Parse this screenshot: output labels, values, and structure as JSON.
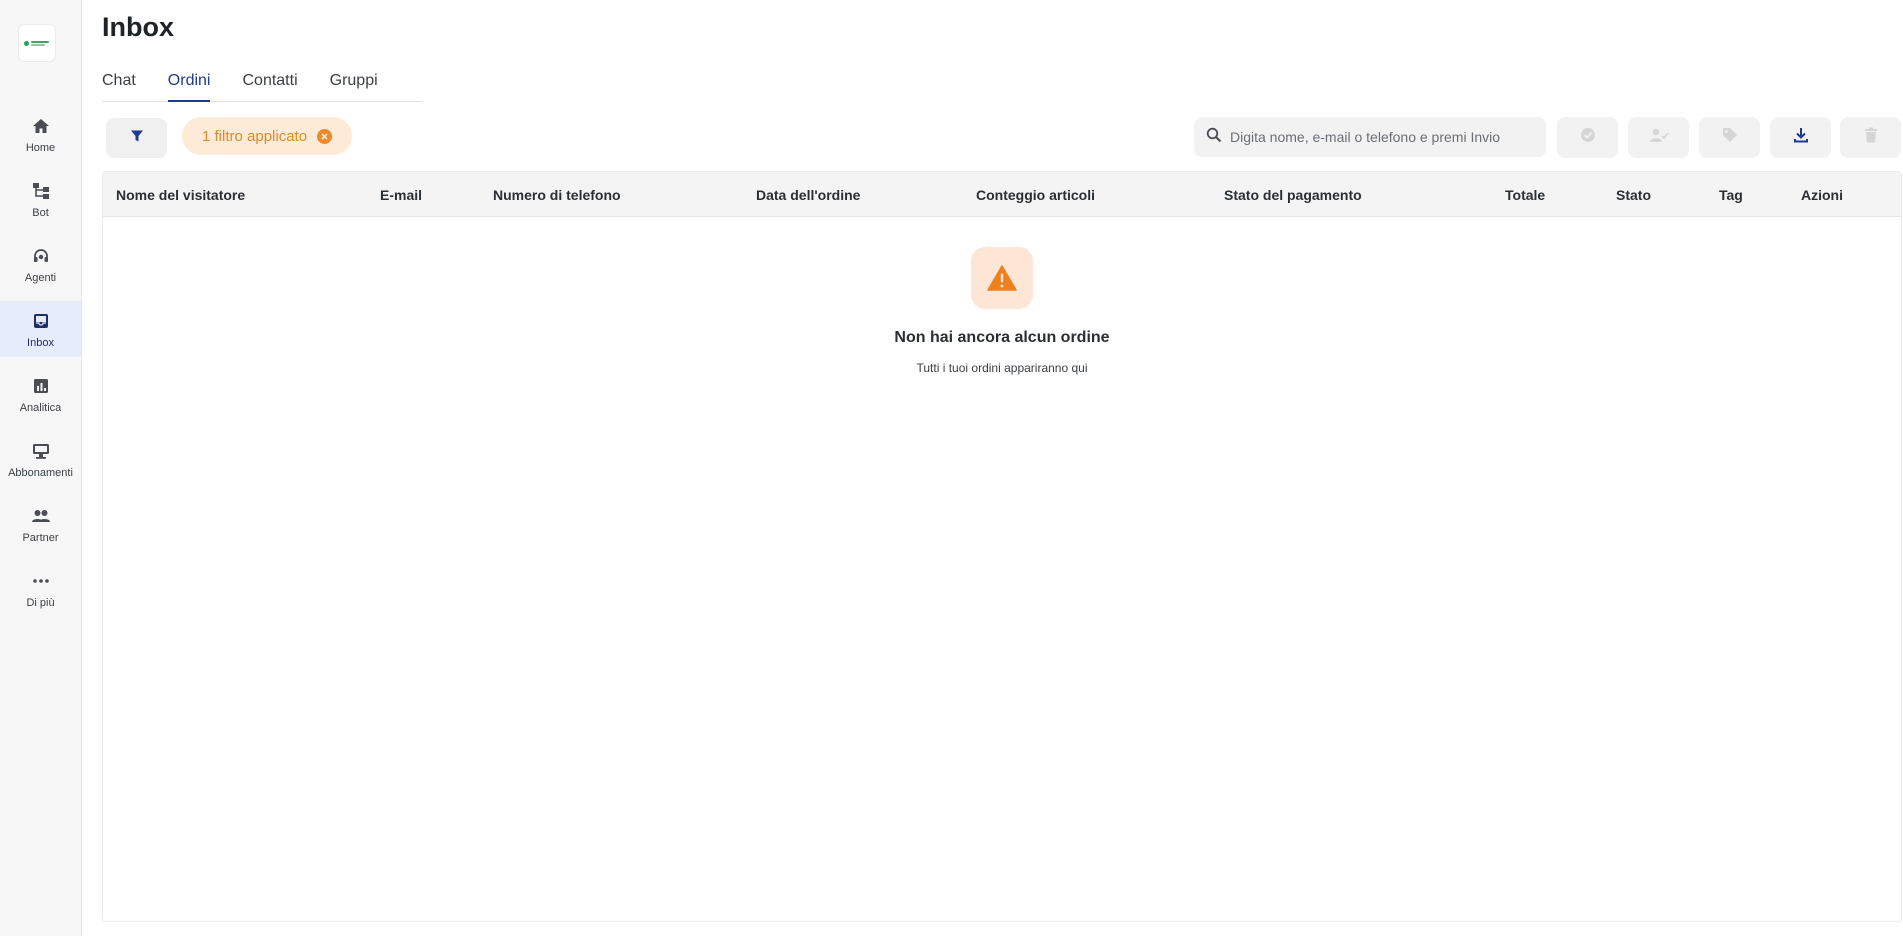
{
  "page": {
    "title": "Inbox"
  },
  "sidebar": {
    "items": [
      {
        "label": "Home",
        "icon": "home-icon"
      },
      {
        "label": "Bot",
        "icon": "bot-icon"
      },
      {
        "label": "Agenti",
        "icon": "headset-icon"
      },
      {
        "label": "Inbox",
        "icon": "inbox-icon",
        "active": true
      },
      {
        "label": "Analitica",
        "icon": "analytics-icon"
      },
      {
        "label": "Abbonamenti",
        "icon": "subscriptions-icon"
      },
      {
        "label": "Partner",
        "icon": "partner-icon"
      },
      {
        "label": "Di più",
        "icon": "more-icon"
      }
    ]
  },
  "tabs": [
    {
      "label": "Chat"
    },
    {
      "label": "Ordini",
      "active": true
    },
    {
      "label": "Contatti"
    },
    {
      "label": "Gruppi"
    }
  ],
  "filters": {
    "chip_label": "1 filtro applicato"
  },
  "search": {
    "placeholder": "Digita nome, e-mail o telefono e premi Invio",
    "value": ""
  },
  "toolbar": {
    "icons": [
      "check-circle-icon",
      "assign-user-icon",
      "tag-icon",
      "download-icon",
      "delete-icon"
    ]
  },
  "table": {
    "columns": [
      "Nome del visitatore",
      "E-mail",
      "Numero di telefono",
      "Data dell'ordine",
      "Conteggio articoli",
      "Stato del pagamento",
      "Totale",
      "Stato",
      "Tag",
      "Azioni"
    ],
    "rows": []
  },
  "empty_state": {
    "title": "Non hai ancora alcun ordine",
    "subtitle": "Tutti i tuoi ordini appariranno qui",
    "icon": "warning-icon"
  },
  "colors": {
    "accent": "#1f3a93",
    "chip_bg": "#fdebd8",
    "chip_text": "#e08a2a",
    "warning": "#f07f1d"
  }
}
